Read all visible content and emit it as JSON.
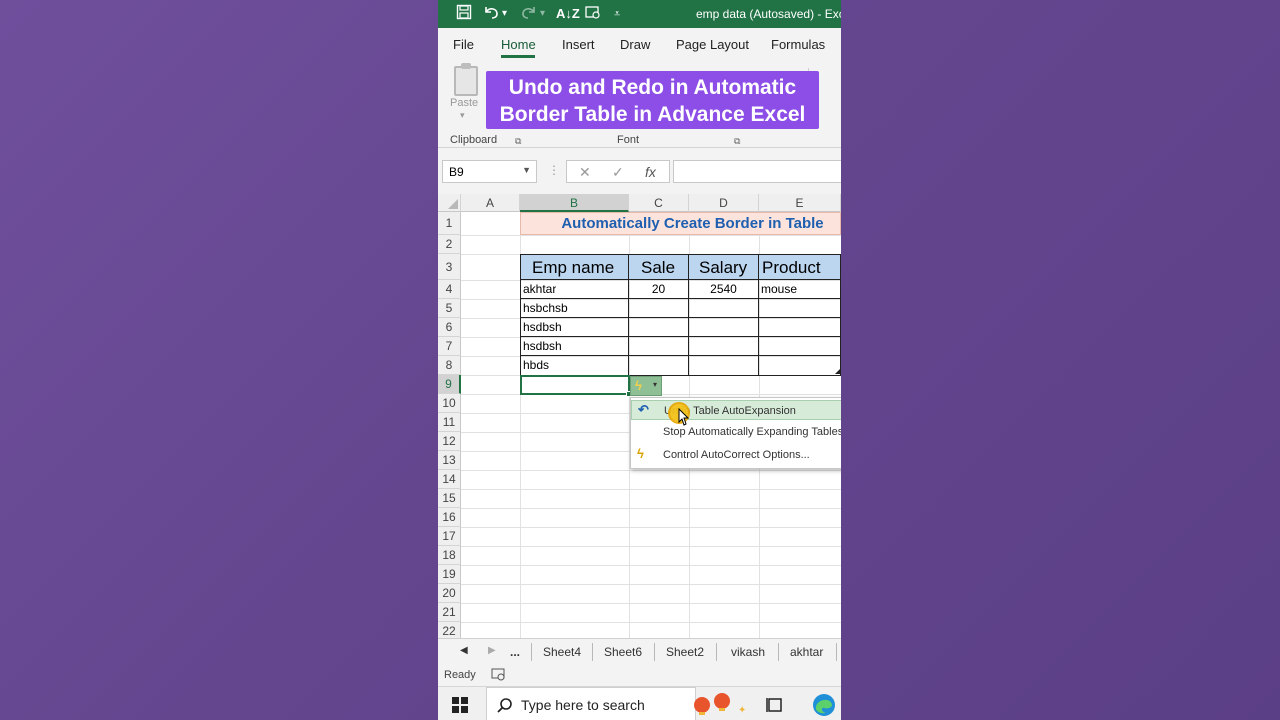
{
  "window": {
    "title": "emp data (Autosaved)  -  Exc",
    "quick_access": [
      "save-icon",
      "undo-icon",
      "redo-icon",
      "sort-icon",
      "form-icon",
      "customize-icon"
    ]
  },
  "ribbon": {
    "tabs": [
      "File",
      "Home",
      "Insert",
      "Draw",
      "Page Layout",
      "Formulas"
    ],
    "active_tab": "Home",
    "paste_label": "Paste",
    "groups": [
      "Clipboard",
      "Font"
    ]
  },
  "overlay_banner": {
    "line1": "Undo and Redo in Automatic",
    "line2": "Border Table in Advance Excel"
  },
  "formula_bar": {
    "name_box": "B9",
    "fx": "fx",
    "cancel": "✕",
    "enter": "✓",
    "formula": ""
  },
  "sheet": {
    "columns": [
      "A",
      "B",
      "C",
      "D",
      "E"
    ],
    "rows": [
      "1",
      "2",
      "3",
      "4",
      "5",
      "6",
      "7",
      "8",
      "9",
      "10",
      "11",
      "12",
      "13",
      "14",
      "15",
      "16",
      "17",
      "18",
      "19",
      "20",
      "21",
      "22"
    ],
    "title_cell": "Automatically Create Border in Table",
    "headers": [
      "Emp name",
      "Sale",
      "Salary",
      "Product"
    ],
    "data": [
      [
        "akhtar",
        "20",
        "2540",
        "mouse"
      ],
      [
        "hsbchsb",
        "",
        "",
        ""
      ],
      [
        "hsdbsh",
        "",
        "",
        ""
      ],
      [
        "hsdbsh",
        "",
        "",
        ""
      ],
      [
        "hbds",
        "",
        "",
        ""
      ]
    ],
    "selected_cell": "B9",
    "colors": {
      "title_fill": "#fce4dc",
      "title_text": "#1f5fb0",
      "header_fill": "#bcd6f0"
    }
  },
  "autocorrect_menu": {
    "items": [
      {
        "label": "Undo Table AutoExpansion",
        "icon": "undo-icon",
        "highlighted": true
      },
      {
        "label": "Stop Automatically Expanding Tables",
        "icon": "",
        "highlighted": false
      },
      {
        "label": "Control AutoCorrect Options...",
        "icon": "autocorrect-lightning-icon",
        "highlighted": false
      }
    ]
  },
  "sheet_tabs": {
    "more": "...",
    "tabs": [
      "Sheet4",
      "Sheet6",
      "Sheet2",
      "vikash",
      "akhtar"
    ]
  },
  "status": {
    "text": "Ready"
  },
  "taskbar": {
    "search_placeholder": "Type here to search"
  }
}
